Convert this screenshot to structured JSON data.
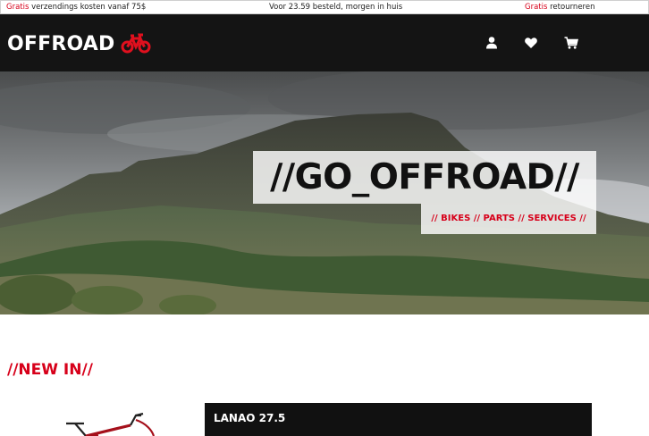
{
  "topbar": {
    "left_accent": "Gratis",
    "left_text": " verzendings kosten vanaf 75$",
    "center_text": "Voor 23.59 besteld, morgen in huis",
    "right_accent": "Gratis",
    "right_text": " retourneren"
  },
  "header": {
    "logo_text": "OFFROAD",
    "logo_icon": "bicycle-icon",
    "icons": [
      "user-icon",
      "heart-icon",
      "cart-icon"
    ]
  },
  "hero": {
    "title": "//GO_OFFROAD//",
    "subtitle": "// BIKES // PARTS // SERVICES //"
  },
  "new_in": {
    "title": "//NEW IN//",
    "product": {
      "name": "LANAO 27.5",
      "image_icon": "bicycle-image"
    }
  },
  "colors": {
    "accent": "#d7001a",
    "header_bg": "#141414",
    "product_bar_bg": "#111111"
  }
}
